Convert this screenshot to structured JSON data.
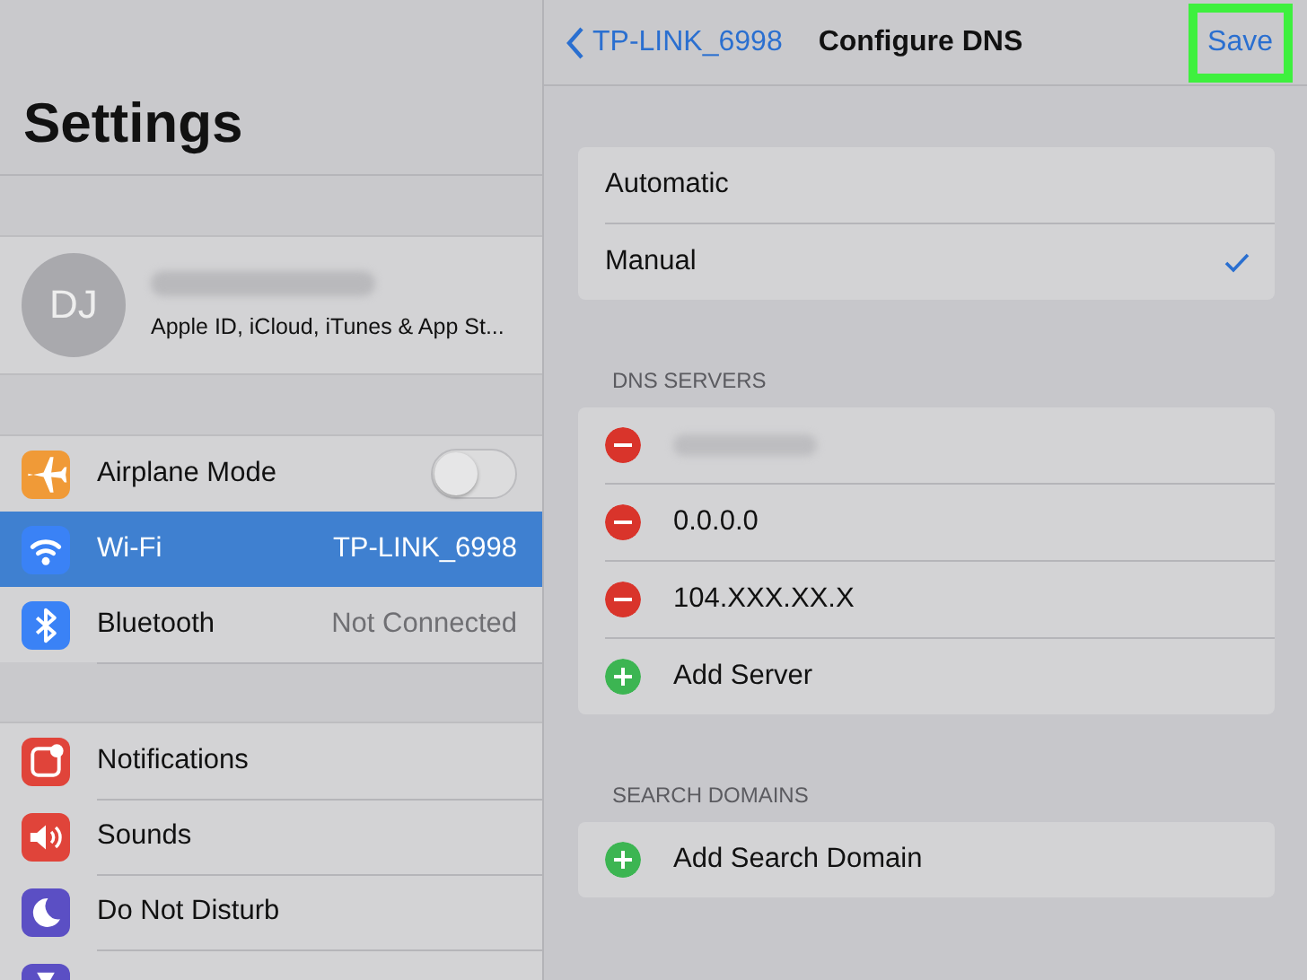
{
  "sidebar": {
    "title": "Settings",
    "profile": {
      "initials": "DJ",
      "subtitle": "Apple ID, iCloud, iTunes & App St..."
    },
    "groups": [
      [
        {
          "label": "Airplane Mode",
          "color": "#f09a37",
          "kind": "toggle",
          "on": false,
          "selected": false
        },
        {
          "label": "Wi-Fi",
          "color": "#3a82f6",
          "kind": "value",
          "value": "TP-LINK_6998",
          "selected": true
        },
        {
          "label": "Bluetooth",
          "color": "#3a82f6",
          "kind": "value",
          "value": "Not Connected",
          "selected": false
        }
      ],
      [
        {
          "label": "Notifications",
          "color": "#e0443a",
          "kind": "plain",
          "selected": false
        },
        {
          "label": "Sounds",
          "color": "#e0443a",
          "kind": "plain",
          "selected": false
        },
        {
          "label": "Do Not Disturb",
          "color": "#5b4fc4",
          "kind": "plain",
          "selected": false
        },
        {
          "color": "#5b4fc4",
          "kind": "plain",
          "selected": false
        }
      ]
    ]
  },
  "detail": {
    "back": "TP-LINK_6998",
    "title": "Configure DNS",
    "save": "Save",
    "modes": [
      {
        "label": "Automatic",
        "selected": false
      },
      {
        "label": "Manual",
        "selected": true
      }
    ],
    "sections": [
      {
        "header": "DNS SERVERS",
        "rows": [
          {
            "kind": "remove",
            "redacted": true
          },
          {
            "kind": "remove",
            "text": "0.0.0.0"
          },
          {
            "kind": "remove",
            "text": "104.XXX.XX.X"
          },
          {
            "kind": "add",
            "text": "Add Server"
          }
        ]
      },
      {
        "header": "SEARCH DOMAINS",
        "rows": [
          {
            "kind": "add",
            "text": "Add Search Domain"
          }
        ]
      }
    ]
  }
}
